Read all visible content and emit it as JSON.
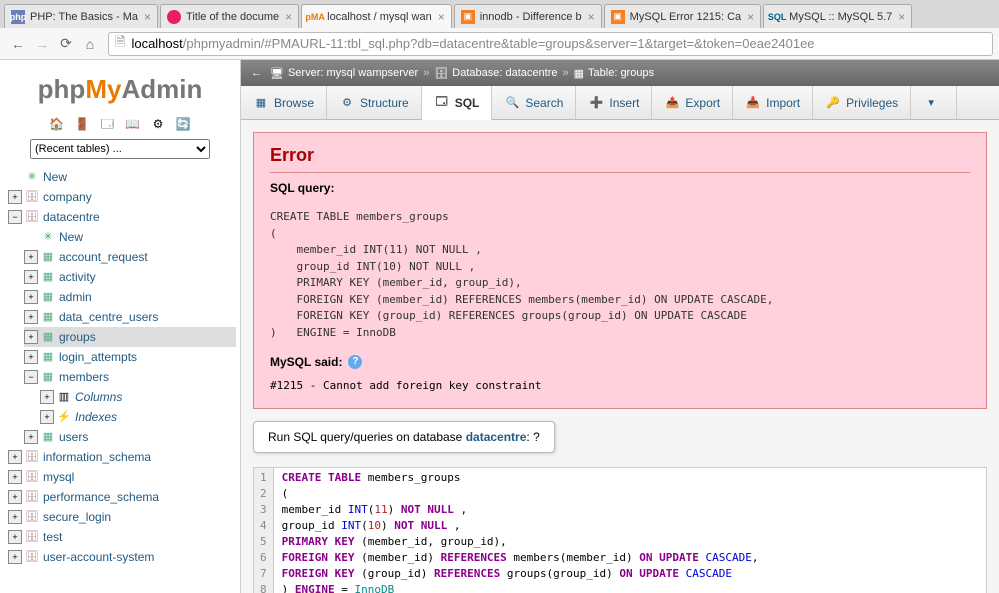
{
  "browser": {
    "tabs": [
      {
        "title": "PHP: The Basics - Ma",
        "fav": "php"
      },
      {
        "title": "Title of the docume",
        "fav": "pink"
      },
      {
        "title": "localhost / mysql wan",
        "fav": "pma",
        "active": true
      },
      {
        "title": "innodb - Difference b",
        "fav": "so"
      },
      {
        "title": "MySQL Error 1215: Ca",
        "fav": "so"
      },
      {
        "title": "MySQL :: MySQL 5.7",
        "fav": "mysql"
      }
    ],
    "url_host": "localhost",
    "url_path": "/phpmyadmin/#PMAURL-11:tbl_sql.php?db=datacentre&table=groups&server=1&target=&token=0eae2401ee"
  },
  "logo": {
    "p1": "php",
    "p2": "My",
    "p3": "Admin"
  },
  "recent_tables": "(Recent tables) ...",
  "tree": {
    "new": "New",
    "dbs": [
      "company"
    ],
    "current_db": "datacentre",
    "db_children": {
      "new": "New",
      "tables": [
        "account_request",
        "activity",
        "admin",
        "data_centre_users",
        "groups",
        "login_attempts"
      ],
      "members": "members",
      "members_children": [
        "Columns",
        "Indexes"
      ],
      "users": "users"
    },
    "other_dbs": [
      "information_schema",
      "mysql",
      "performance_schema",
      "secure_login",
      "test",
      "user-account-system"
    ]
  },
  "breadcrumb": {
    "server_label": "Server:",
    "server": "mysql wampserver",
    "db_label": "Database:",
    "db": "datacentre",
    "table_label": "Table:",
    "table": "groups"
  },
  "tabs": [
    "Browse",
    "Structure",
    "SQL",
    "Search",
    "Insert",
    "Export",
    "Import",
    "Privileges"
  ],
  "active_tab": "SQL",
  "error": {
    "heading": "Error",
    "sql_query_label": "SQL query:",
    "sql_text": "CREATE TABLE members_groups\n(\n    member_id INT(11) NOT NULL ,\n    group_id INT(10) NOT NULL ,\n    PRIMARY KEY (member_id, group_id),\n    FOREIGN KEY (member_id) REFERENCES members(member_id) ON UPDATE CASCADE,\n    FOREIGN KEY (group_id) REFERENCES groups(group_id) ON UPDATE CASCADE\n)   ENGINE = InnoDB",
    "mysql_said": "MySQL said:",
    "err_msg": "#1215 - Cannot add foreign key constraint"
  },
  "sql_panel": {
    "prefix": "Run SQL query/queries on database ",
    "db": "datacentre",
    "suffix": ":",
    "code_lines": [
      "CREATE TABLE members_groups",
      "(",
      "    member_id INT(11) NOT NULL ,",
      "    group_id INT(10) NOT NULL ,",
      "    PRIMARY KEY (member_id, group_id),",
      "    FOREIGN KEY (member_id) REFERENCES members(member_id) ON UPDATE CASCADE,",
      "    FOREIGN KEY (group_id) REFERENCES groups(group_id) ON UPDATE CASCADE",
      ")   ENGINE = InnoDB"
    ]
  }
}
